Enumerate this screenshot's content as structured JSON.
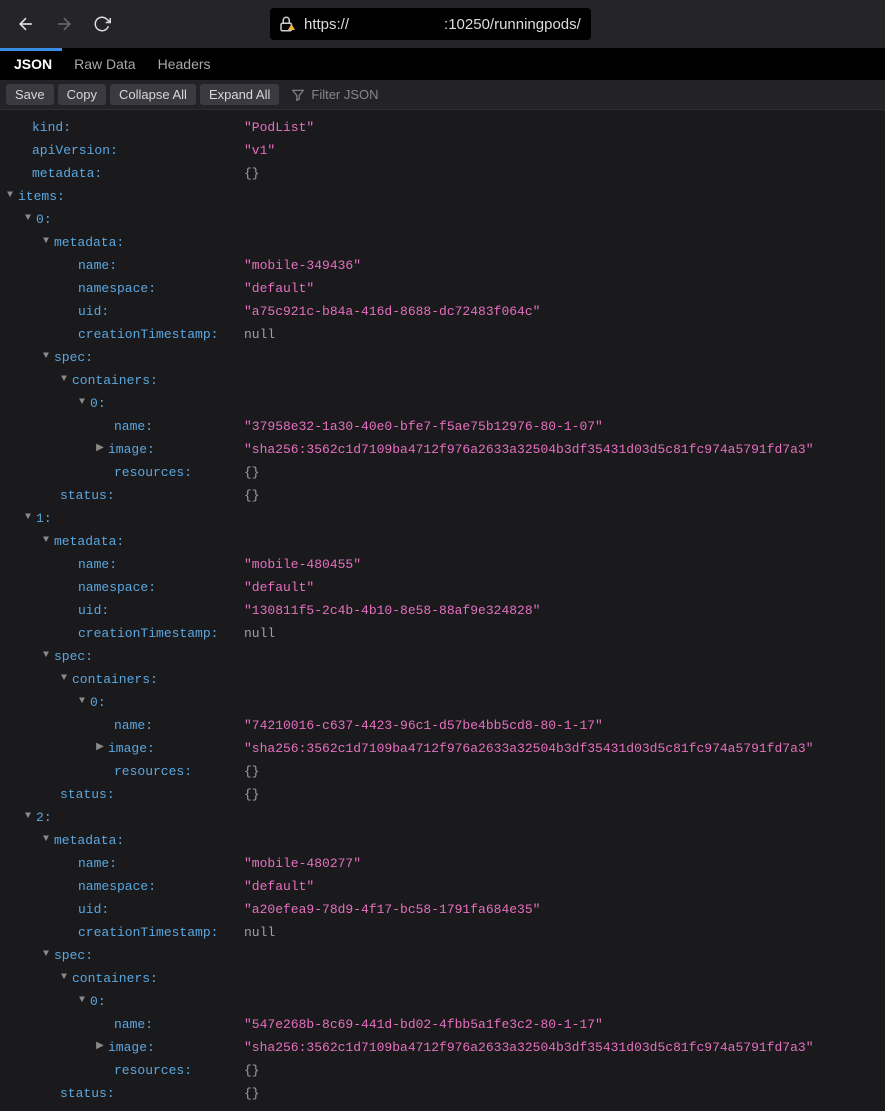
{
  "nav": {
    "url_prefix": "https://",
    "url_suffix": ":10250/runningpods/"
  },
  "tabs": {
    "json": "JSON",
    "raw": "Raw Data",
    "headers": "Headers"
  },
  "toolbar": {
    "save": "Save",
    "copy": "Copy",
    "collapse": "Collapse All",
    "expand": "Expand All",
    "filter_placeholder": "Filter JSON"
  },
  "json": {
    "kind_key": "kind",
    "kind_val": "\"PodList\"",
    "apiVersion_key": "apiVersion",
    "apiVersion_val": "\"v1\"",
    "metadata_key": "metadata",
    "empty_obj": "{}",
    "items_key": "items",
    "idx0": "0",
    "idx1": "1",
    "idx2": "2",
    "meta_key": "metadata",
    "name_key": "name",
    "namespace_key": "namespace",
    "uid_key": "uid",
    "creation_key": "creationTimestamp",
    "null_val": "null",
    "spec_key": "spec",
    "containers_key": "containers",
    "image_key": "image",
    "resources_key": "resources",
    "status_key": "status",
    "p0_name": "\"mobile-349436\"",
    "p0_ns": "\"default\"",
    "p0_uid": "\"a75c921c-b84a-416d-8688-dc72483f064c\"",
    "p0_cname": "\"37958e32-1a30-40e0-bfe7-f5ae75b12976-80-1-07\"",
    "p0_img": "\"sha256:3562c1d7109ba4712f976a2633a32504b3df35431d03d5c81fc974a5791fd7a3\"",
    "p1_name": "\"mobile-480455\"",
    "p1_ns": "\"default\"",
    "p1_uid": "\"130811f5-2c4b-4b10-8e58-88af9e324828\"",
    "p1_cname": "\"74210016-c637-4423-96c1-d57be4bb5cd8-80-1-17\"",
    "p1_img": "\"sha256:3562c1d7109ba4712f976a2633a32504b3df35431d03d5c81fc974a5791fd7a3\"",
    "p2_name": "\"mobile-480277\"",
    "p2_ns": "\"default\"",
    "p2_uid": "\"a20efea9-78d9-4f17-bc58-1791fa684e35\"",
    "p2_cname": "\"547e268b-8c69-441d-bd02-4fbb5a1fe3c2-80-1-17\"",
    "p2_img": "\"sha256:3562c1d7109ba4712f976a2633a32504b3df35431d03d5c81fc974a5791fd7a3\""
  }
}
